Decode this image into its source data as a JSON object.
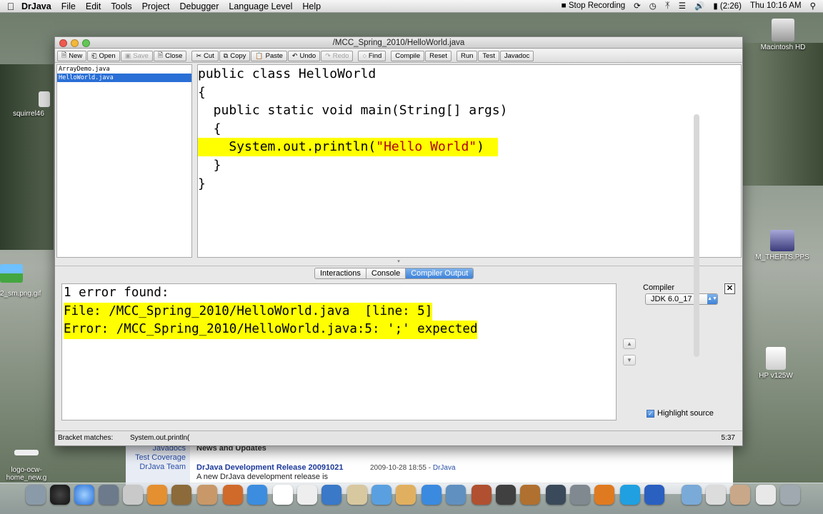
{
  "menubar": {
    "app": "DrJava",
    "items": [
      "File",
      "Edit",
      "Tools",
      "Project",
      "Debugger",
      "Language Level",
      "Help"
    ],
    "status": {
      "recording": "Stop Recording",
      "battery": "(2:26)",
      "clock": "Thu 10:16 AM"
    }
  },
  "window": {
    "title": "/MCC_Spring_2010/HelloWorld.java",
    "toolbar": [
      {
        "label": "New",
        "icon": "new-file-icon",
        "enabled": true
      },
      {
        "label": "Open",
        "icon": "open-icon",
        "enabled": true
      },
      {
        "label": "Save",
        "icon": "save-icon",
        "enabled": false
      },
      {
        "label": "Close",
        "icon": "close-file-icon",
        "enabled": true
      },
      {
        "label": "Cut",
        "icon": "cut-icon",
        "enabled": true
      },
      {
        "label": "Copy",
        "icon": "copy-icon",
        "enabled": true
      },
      {
        "label": "Paste",
        "icon": "paste-icon",
        "enabled": true
      },
      {
        "label": "Undo",
        "icon": "undo-icon",
        "enabled": true
      },
      {
        "label": "Redo",
        "icon": "redo-icon",
        "enabled": false
      },
      {
        "label": "Find",
        "icon": "binoculars-icon",
        "enabled": true
      },
      {
        "label": "Compile",
        "icon": "",
        "enabled": true
      },
      {
        "label": "Reset",
        "icon": "",
        "enabled": true
      },
      {
        "label": "Run",
        "icon": "",
        "enabled": true
      },
      {
        "label": "Test",
        "icon": "",
        "enabled": true
      },
      {
        "label": "Javadoc",
        "icon": "",
        "enabled": true
      }
    ],
    "files": [
      {
        "name": "ArrayDemo.java",
        "selected": false
      },
      {
        "name": "HelloWorld.java",
        "selected": true
      }
    ],
    "code": [
      "public class HelloWorld",
      "{",
      "  public static void main(String[] args)",
      "  {",
      "    System.out.println(",
      "  }",
      "}"
    ],
    "code_string": "\"Hello World\"",
    "code_close": ")",
    "tabs": [
      {
        "label": "Interactions",
        "active": false
      },
      {
        "label": "Console",
        "active": false
      },
      {
        "label": "Compiler Output",
        "active": true
      }
    ],
    "output": {
      "summary": "1 error found:",
      "file_line": "File: /MCC_Spring_2010/HelloWorld.java  [line: 5]",
      "error_line": "Error: /MCC_Spring_2010/HelloWorld.java:5: ';' expected"
    },
    "compiler": {
      "label": "Compiler",
      "selected": "JDK 6.0_17",
      "highlight_source": "Highlight source",
      "highlight_checked": true
    },
    "status": {
      "label": "Bracket matches:",
      "value": "System.out.println(",
      "position": "5:37"
    }
  },
  "background_page": {
    "side_links": [
      "Javadocs",
      "Test Coverage",
      "DrJava Team"
    ],
    "heading": "News and Updates",
    "release": "DrJava Development Release 20091021",
    "date": "2009-10-28 18:55 - ",
    "author": "DrJava",
    "snippet": "A new DrJava development release is"
  },
  "desktop_icons": [
    {
      "label": "Macintosh HD"
    },
    {
      "label": "squirrel46"
    },
    {
      "label": "M_THEFTS.PPS"
    },
    {
      "label": "2_sm.png.gif"
    },
    {
      "label": "HP v125W"
    },
    {
      "label": "logo-ocw-home_new.g"
    }
  ],
  "colors": {
    "highlight": "#ffff00",
    "selection": "#2a6fd6",
    "string": "#b00000",
    "tab_active": "#3d82d9"
  }
}
